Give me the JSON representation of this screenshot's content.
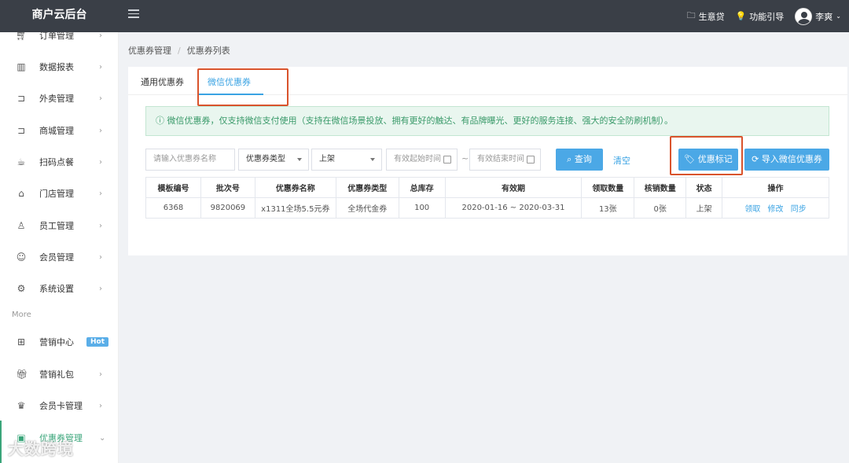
{
  "app": {
    "title": "商户云后台"
  },
  "header": {
    "links": [
      {
        "icon": "folder-icon",
        "label": "生意贷"
      },
      {
        "icon": "lightbulb-icon",
        "label": "功能引导"
      }
    ],
    "user": {
      "name": "李爽"
    }
  },
  "sidebar": {
    "items": [
      {
        "icon": "cart-icon",
        "label": "订单管理"
      },
      {
        "icon": "chart-icon",
        "label": "数据报表"
      },
      {
        "icon": "cart-icon",
        "label": "外卖管理"
      },
      {
        "icon": "cart-icon",
        "label": "商城管理"
      },
      {
        "icon": "cup-icon",
        "label": "扫码点餐"
      },
      {
        "icon": "home-icon",
        "label": "门店管理"
      },
      {
        "icon": "user-icon",
        "label": "员工管理"
      },
      {
        "icon": "smile-icon",
        "label": "会员管理"
      },
      {
        "icon": "gear-icon",
        "label": "系统设置"
      }
    ],
    "more_label": "More",
    "more_items": [
      {
        "icon": "grid-icon",
        "label": "营销中心",
        "badge": "Hot"
      },
      {
        "icon": "gift-icon",
        "label": "营销礼包"
      },
      {
        "icon": "crown-icon",
        "label": "会员卡管理"
      },
      {
        "icon": "coupon-icon",
        "label": "优惠券管理"
      }
    ]
  },
  "breadcrumb": [
    "优惠券管理",
    "优惠券列表"
  ],
  "tabs": [
    {
      "label": "通用优惠券",
      "active": false
    },
    {
      "label": "微信优惠券",
      "active": true
    }
  ],
  "notice": "ⓘ 微信优惠券，仅支持微信支付使用（支持在微信场景投放、拥有更好的触达、有品牌曝光、更好的服务连接、强大的安全防刷机制）。",
  "filters": {
    "name_placeholder": "请输入优惠券名称",
    "type_value": "优惠券类型",
    "status_value": "上架",
    "start_placeholder": "有效起始时间",
    "separator": "~",
    "end_placeholder": "有效结束时间"
  },
  "buttons": {
    "search": "查询",
    "clear": "清空",
    "mark": "优惠标记",
    "import": "导入微信优惠券"
  },
  "table": {
    "headers": [
      "模板编号",
      "批次号",
      "优惠券名称",
      "优惠券类型",
      "总库存",
      "有效期",
      "领取数量",
      "核销数量",
      "状态",
      "操作"
    ],
    "rows": [
      {
        "template_no": "6368",
        "batch_no": "9820069",
        "name": "x1311全场5.5元券",
        "type": "全场代金券",
        "stock": "100",
        "validity": "2020-01-16 ~ 2020-03-31",
        "received": "13张",
        "redeemed": "0张",
        "status": "上架",
        "actions": [
          "领取",
          "修改",
          "同步"
        ]
      }
    ]
  },
  "watermark": "大数跨境"
}
